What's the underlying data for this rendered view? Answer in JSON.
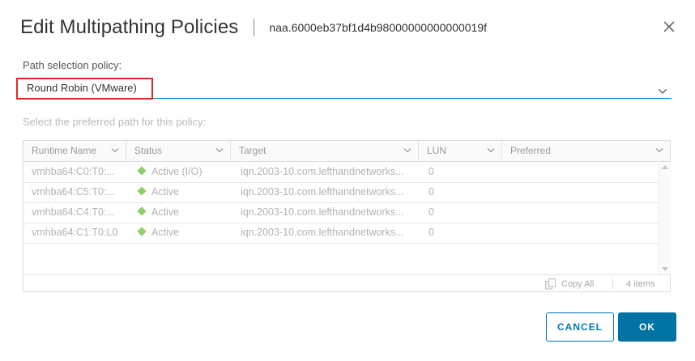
{
  "dialog": {
    "title": "Edit Multipathing Policies",
    "subtitle": "naa.6000eb37bf1d4b98000000000000019f"
  },
  "policy": {
    "label": "Path selection policy:",
    "value": "Round Robin (VMware)"
  },
  "grid": {
    "label": "Select the preferred path for this policy:",
    "columns": [
      "Runtime Name",
      "Status",
      "Target",
      "LUN",
      "Preferred"
    ],
    "rows": [
      {
        "runtime": "vmhba64:C0:T0:...",
        "status": "Active (I/O)",
        "target": "iqn.2003-10.com.lefthandnetworks...",
        "lun": "0",
        "preferred": ""
      },
      {
        "runtime": "vmhba64:C5:T0:...",
        "status": "Active",
        "target": "iqn.2003-10.com.lefthandnetworks...",
        "lun": "0",
        "preferred": ""
      },
      {
        "runtime": "vmhba64:C4:T0:...",
        "status": "Active",
        "target": "iqn.2003-10.com.lefthandnetworks...",
        "lun": "0",
        "preferred": ""
      },
      {
        "runtime": "vmhba64:C1:T0:L0",
        "status": "Active",
        "target": "iqn.2003-10.com.lefthandnetworks...",
        "lun": "0",
        "preferred": ""
      }
    ],
    "footer": {
      "copy_all": "Copy All",
      "count": "4 items"
    }
  },
  "buttons": {
    "cancel": "CANCEL",
    "ok": "OK"
  },
  "colors": {
    "accent": "#0079b8",
    "primary_button": "#0072a3",
    "highlight": "#e12626",
    "status_active": "#8fcf6b"
  },
  "icons": {
    "close": "close-icon",
    "dropdown": "chevron-down-icon",
    "status": "diamond-status-icon",
    "copy": "copy-icon"
  }
}
